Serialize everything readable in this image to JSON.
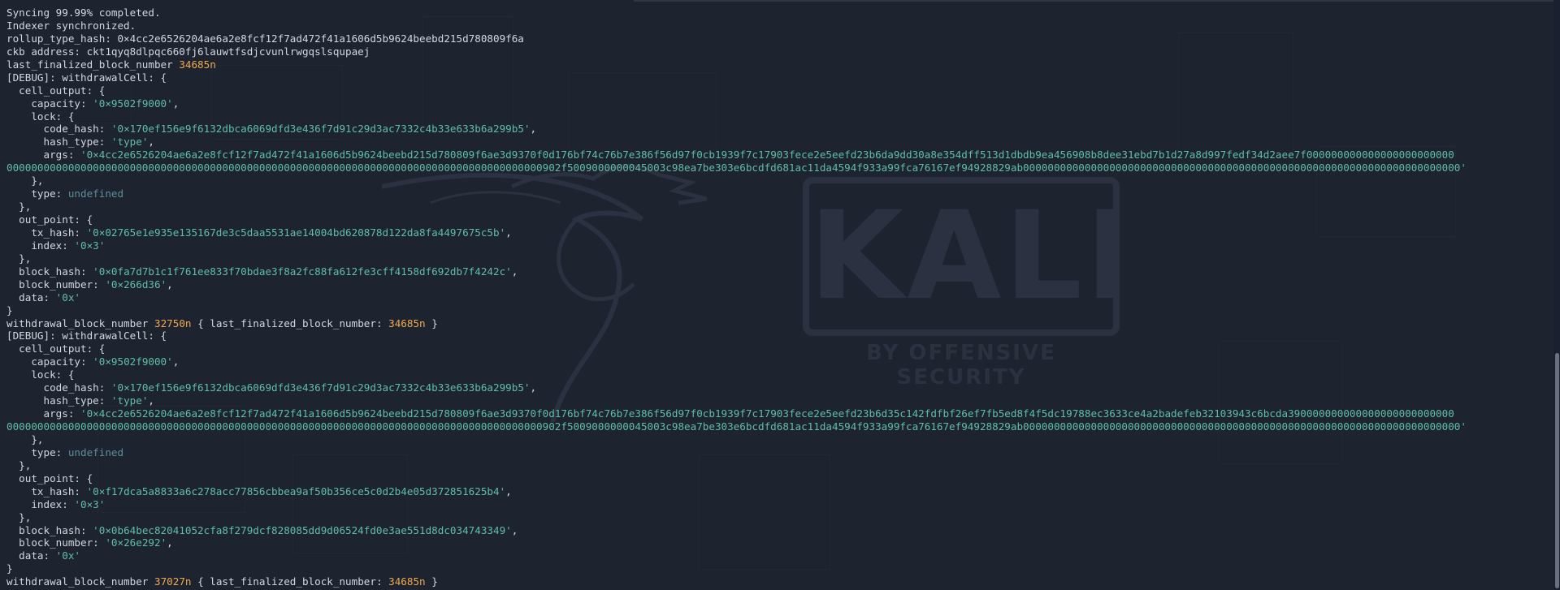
{
  "colors": {
    "background": "#1e2330",
    "text": "#d3d7de",
    "string": "#5fbfa6",
    "number": "#f0a94d",
    "undefined": "#5a8f9a"
  },
  "wallpaper": {
    "wordmark": "KALI",
    "tagline": "BY OFFENSIVE SECURITY",
    "logo_icon": "kali-dragon-icon"
  },
  "lines": [
    [
      {
        "t": "Syncing 99.99% completed."
      }
    ],
    [
      {
        "t": "Indexer synchronized."
      }
    ],
    [
      {
        "t": "rollup_type_hash: 0×4cc2e6526204ae6a2e8fcf12f7ad472f41a1606d5b9624beebd215d780809f6a"
      }
    ],
    [
      {
        "t": "ckb address: ckt1qyq8dlpqc660fj6lauwtfsdjcvunlrwgqslsqupaej"
      }
    ],
    [
      {
        "t": "last_finalized_block_number "
      },
      {
        "t": "34685n",
        "c": "num"
      }
    ],
    [
      {
        "t": "[DEBUG]: withdrawalCell: {"
      }
    ],
    [
      {
        "t": "  cell_output: {"
      }
    ],
    [
      {
        "t": "    capacity: "
      },
      {
        "t": "'0×9502f9000'",
        "c": "str"
      },
      {
        "t": ","
      }
    ],
    [
      {
        "t": "    lock: {"
      }
    ],
    [
      {
        "t": "      code_hash: "
      },
      {
        "t": "'0×170ef156e9f6132dbca6069dfd3e436f7d91c29d3ac7332c4b33e633b6a299b5'",
        "c": "str"
      },
      {
        "t": ","
      }
    ],
    [
      {
        "t": "      hash_type: "
      },
      {
        "t": "'type'",
        "c": "str"
      },
      {
        "t": ","
      }
    ],
    [
      {
        "t": "      args: "
      },
      {
        "t": "'0×4cc2e6526204ae6a2e8fcf12f7ad472f41a1606d5b9624beebd215d780809f6ae3d9370f0d176bf74c76b7e386f56d97f0cb1939f7c17903fece2e5eefd23b6da9dd30a8e354dff513d1dbdb9ea456908b8dee31ebd7b1d27a8d997fedf34d2aee7f000000000000000000000000",
        "c": "str"
      }
    ],
    [
      {
        "t": "000000000000000000000000000000000000000000000000000000000000000000000000000000000000000902f5009000000045003c98ea7be303e6bcdfd681ac11da4594f933a99fca76167ef94928829ab00000000000000000000000000000000000000000000000000000000000000000000000'",
        "c": "str"
      }
    ],
    [
      {
        "t": "    },"
      }
    ],
    [
      {
        "t": "    type: "
      },
      {
        "t": "undefined",
        "c": "undef"
      }
    ],
    [
      {
        "t": "  },"
      }
    ],
    [
      {
        "t": "  out_point: {"
      }
    ],
    [
      {
        "t": "    tx_hash: "
      },
      {
        "t": "'0×02765e1e935e135167de3c5daa5531ae14004bd620878d122da8fa4497675c5b'",
        "c": "str"
      },
      {
        "t": ","
      }
    ],
    [
      {
        "t": "    index: "
      },
      {
        "t": "'0×3'",
        "c": "str"
      }
    ],
    [
      {
        "t": "  },"
      }
    ],
    [
      {
        "t": "  block_hash: "
      },
      {
        "t": "'0×0fa7d7b1c1f761ee833f70bdae3f8a2fc88fa612fe3cff4158df692db7f4242c'",
        "c": "str"
      },
      {
        "t": ","
      }
    ],
    [
      {
        "t": "  block_number: "
      },
      {
        "t": "'0×266d36'",
        "c": "str"
      },
      {
        "t": ","
      }
    ],
    [
      {
        "t": "  data: "
      },
      {
        "t": "'0x'",
        "c": "str"
      }
    ],
    [
      {
        "t": "}"
      }
    ],
    [
      {
        "t": "withdrawal_block_number "
      },
      {
        "t": "32750n",
        "c": "num"
      },
      {
        "t": " { last_finalized_block_number: "
      },
      {
        "t": "34685n",
        "c": "num"
      },
      {
        "t": " }"
      }
    ],
    [
      {
        "t": "[DEBUG]: withdrawalCell: {"
      }
    ],
    [
      {
        "t": "  cell_output: {"
      }
    ],
    [
      {
        "t": "    capacity: "
      },
      {
        "t": "'0×9502f9000'",
        "c": "str"
      },
      {
        "t": ","
      }
    ],
    [
      {
        "t": "    lock: {"
      }
    ],
    [
      {
        "t": "      code_hash: "
      },
      {
        "t": "'0×170ef156e9f6132dbca6069dfd3e436f7d91c29d3ac7332c4b33e633b6a299b5'",
        "c": "str"
      },
      {
        "t": ","
      }
    ],
    [
      {
        "t": "      hash_type: "
      },
      {
        "t": "'type'",
        "c": "str"
      },
      {
        "t": ","
      }
    ],
    [
      {
        "t": "      args: "
      },
      {
        "t": "'0×4cc2e6526204ae6a2e8fcf12f7ad472f41a1606d5b9624beebd215d780809f6ae3d9370f0d176bf74c76b7e386f56d97f0cb1939f7c17903fece2e5eefd23b6d35c142fdfbf26ef7fb5ed8f4f5dc19788ec3633ce4a2badefeb32103943c6bcda390000000000000000000000000",
        "c": "str"
      }
    ],
    [
      {
        "t": "000000000000000000000000000000000000000000000000000000000000000000000000000000000000000902f5009000000045003c98ea7be303e6bcdfd681ac11da4594f933a99fca76167ef94928829ab00000000000000000000000000000000000000000000000000000000000000000000000'",
        "c": "str"
      }
    ],
    [
      {
        "t": "    },"
      }
    ],
    [
      {
        "t": "    type: "
      },
      {
        "t": "undefined",
        "c": "undef"
      }
    ],
    [
      {
        "t": "  },"
      }
    ],
    [
      {
        "t": "  out_point: {"
      }
    ],
    [
      {
        "t": "    tx_hash: "
      },
      {
        "t": "'0×f17dca5a8833a6c278acc77856cbbea9af50b356ce5c0d2b4e05d372851625b4'",
        "c": "str"
      },
      {
        "t": ","
      }
    ],
    [
      {
        "t": "    index: "
      },
      {
        "t": "'0×3'",
        "c": "str"
      }
    ],
    [
      {
        "t": "  },"
      }
    ],
    [
      {
        "t": "  block_hash: "
      },
      {
        "t": "'0×0b64bec82041052cfa8f279dcf828085dd9d06524fd0e3ae551d8dc034743349'",
        "c": "str"
      },
      {
        "t": ","
      }
    ],
    [
      {
        "t": "  block_number: "
      },
      {
        "t": "'0×26e292'",
        "c": "str"
      },
      {
        "t": ","
      }
    ],
    [
      {
        "t": "  data: "
      },
      {
        "t": "'0x'",
        "c": "str"
      }
    ],
    [
      {
        "t": "}"
      }
    ],
    [
      {
        "t": "withdrawal_block_number "
      },
      {
        "t": "37027n",
        "c": "num"
      },
      {
        "t": " { last_finalized_block_number: "
      },
      {
        "t": "34685n",
        "c": "num"
      },
      {
        "t": " }"
      }
    ]
  ]
}
